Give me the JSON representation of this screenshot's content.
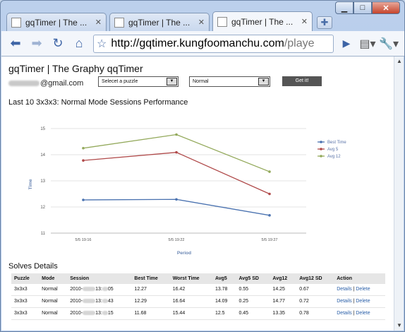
{
  "browser": {
    "tabs": [
      {
        "title": "gqTimer | The ...",
        "active": false
      },
      {
        "title": "gqTimer | The ...",
        "active": false
      },
      {
        "title": "gqTimer | The ...",
        "active": true
      }
    ],
    "url_host": "http://gqtimer.kungfoomanchu.com",
    "url_rest": "/playe"
  },
  "page": {
    "title": "gqTimer | The Graphy qqTimer",
    "email_suffix": "@gmail.com",
    "puzzle_select": "Selecet a puzzle",
    "mode_select": "Normal",
    "get_it": "Get it!",
    "chart_heading": "Last 10 3x3x3: Normal Mode Sessions Performance",
    "solves_heading": "Solves Details"
  },
  "chart_data": {
    "type": "line",
    "categories": [
      "5/5 19:16",
      "5/5 19:22",
      "5/5 19:27"
    ],
    "series": [
      {
        "name": "Best Time",
        "color": "#4a72b0",
        "values": [
          12.27,
          12.29,
          11.68
        ]
      },
      {
        "name": "Avg 5",
        "color": "#b04a4a",
        "values": [
          13.78,
          14.09,
          12.5
        ]
      },
      {
        "name": "Avg 12",
        "color": "#93a95b",
        "values": [
          14.25,
          14.77,
          13.35
        ]
      }
    ],
    "yticks": [
      "15",
      "14",
      "13",
      "12",
      "11"
    ],
    "ylim": [
      11,
      15
    ],
    "xlabel": "Period",
    "ylabel": "Time",
    "legend": "right",
    "grid": true
  },
  "table": {
    "headers": [
      "Puzzle",
      "Mode",
      "Session",
      "Best Time",
      "Worst Time",
      "Avg5",
      "Avg5 SD",
      "Avg12",
      "Avg12 SD",
      "Action"
    ],
    "rows": [
      {
        "puzzle": "3x3x3",
        "mode": "Normal",
        "session_a": "2010-",
        "session_b": "13:",
        "session_c": "05",
        "best": "12.27",
        "worst": "16.42",
        "avg5": "13.78",
        "avg5sd": "0.55",
        "avg12": "14.25",
        "avg12sd": "0.67"
      },
      {
        "puzzle": "3x3x3",
        "mode": "Normal",
        "session_a": "2010-",
        "session_b": "13:",
        "session_c": "43",
        "best": "12.29",
        "worst": "16.64",
        "avg5": "14.09",
        "avg5sd": "0.25",
        "avg12": "14.77",
        "avg12sd": "0.72"
      },
      {
        "puzzle": "3x3x3",
        "mode": "Normal",
        "session_a": "2010-",
        "session_b": "13:",
        "session_c": "15",
        "best": "11.68",
        "worst": "15.44",
        "avg5": "12.5",
        "avg5sd": "0.45",
        "avg12": "13.35",
        "avg12sd": "0.78"
      }
    ],
    "details_label": "Details",
    "separator": "|",
    "delete_label": "Delete"
  }
}
